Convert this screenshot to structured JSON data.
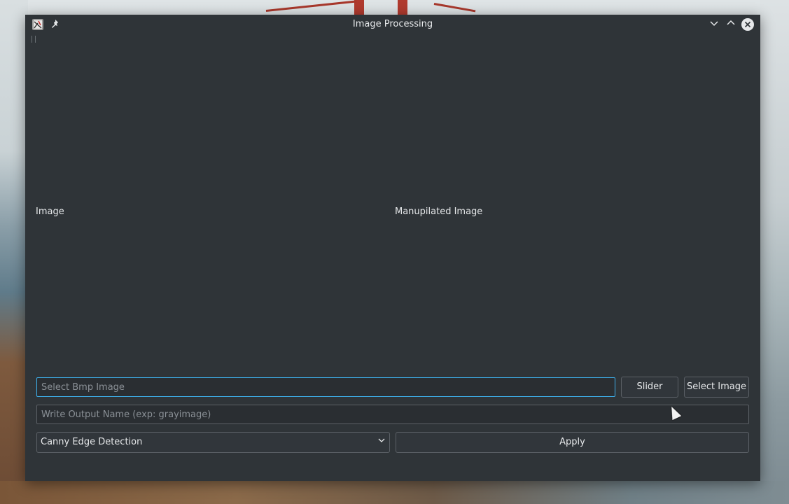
{
  "window": {
    "title": "Image Processing"
  },
  "titlebar": {
    "app_icon": "app-icon",
    "pin_icon": "pin-icon",
    "minimize_icon": "chevron-down-icon",
    "maximize_icon": "chevron-up-icon",
    "close_icon": "close-icon"
  },
  "panels": {
    "original_label": "Image",
    "manipulated_label": "Manupilated Image"
  },
  "controls": {
    "bmp_input": {
      "value": "",
      "placeholder": "Select Bmp Image"
    },
    "slider_button": "Slider",
    "select_image_button": "Select Image",
    "output_input": {
      "value": "",
      "placeholder": "Write Output Name (exp: grayimage)"
    },
    "operation_select": {
      "selected": "Canny Edge Detection"
    },
    "apply_button": "Apply"
  },
  "colors": {
    "window_bg": "#2f3438",
    "focus_accent": "#3daee9",
    "text": "#e6e8ea"
  }
}
